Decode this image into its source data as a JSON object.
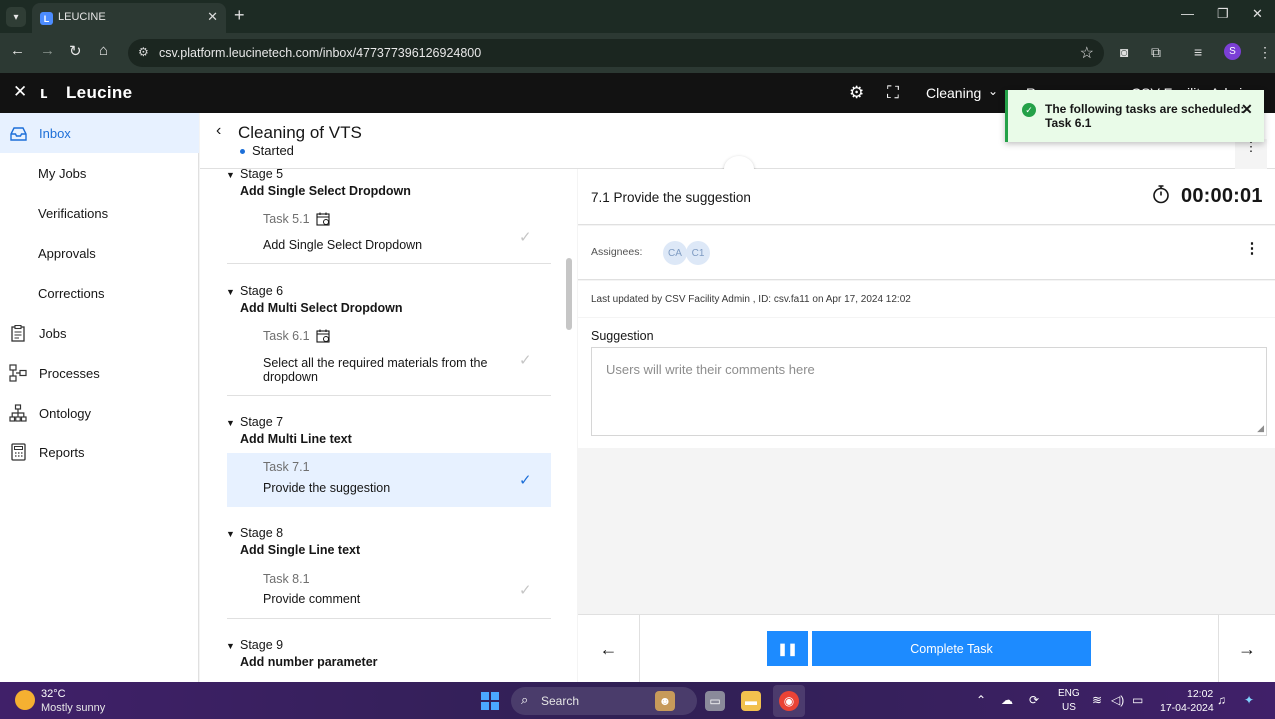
{
  "browser": {
    "tab_title": "LEUCINE",
    "url": "csv.platform.leucinetech.com/inbox/477377396126924800",
    "profile_initial": "S"
  },
  "app": {
    "brand": "Leucine",
    "facility": "Cleaning",
    "header_cut_left": "R",
    "header_cut_right": "CSV Facility Admin"
  },
  "sidebar": {
    "items": [
      {
        "label": "Inbox",
        "icon": "inbox-icon"
      },
      {
        "label": "My Jobs"
      },
      {
        "label": "Verifications"
      },
      {
        "label": "Approvals"
      },
      {
        "label": "Corrections"
      },
      {
        "label": "Jobs",
        "icon": "clipboard-icon"
      },
      {
        "label": "Processes",
        "icon": "processes-icon"
      },
      {
        "label": "Ontology",
        "icon": "ontology-icon"
      },
      {
        "label": "Reports",
        "icon": "reports-icon"
      }
    ]
  },
  "job": {
    "title": "Cleaning of VTS",
    "status": "Started"
  },
  "stages": [
    {
      "label": "Stage 5",
      "name": "Add Single Select Dropdown",
      "task": {
        "id": "Task 5.1",
        "name": "Add Single Select Dropdown",
        "scheduled": true
      }
    },
    {
      "label": "Stage 6",
      "name": "Add Multi Select Dropdown",
      "task": {
        "id": "Task 6.1",
        "name": "Select all the required materials from the dropdown",
        "scheduled": true
      }
    },
    {
      "label": "Stage 7",
      "name": "Add Multi Line text",
      "task": {
        "id": "Task 7.1",
        "name": "Provide the suggestion",
        "scheduled": false
      }
    },
    {
      "label": "Stage 8",
      "name": "Add Single Line text",
      "task": {
        "id": "Task 8.1",
        "name": "Provide comment",
        "scheduled": false
      }
    },
    {
      "label": "Stage 9",
      "name": "Add number parameter"
    }
  ],
  "task_detail": {
    "title": "7.1 Provide the suggestion",
    "timer": "00:00:01",
    "assignees_label": "Assignees:",
    "assignees": [
      "CA",
      "C1"
    ],
    "last_updated": "Last updated by CSV Facility Admin , ID: csv.fa11 on Apr 17, 2024 12:02",
    "parameter_label": "Suggestion",
    "parameter_placeholder": "Users will write their comments here"
  },
  "actions": {
    "complete_label": "Complete Task"
  },
  "toast": {
    "message": "The following tasks are scheduled: Task 6.1"
  },
  "taskbar": {
    "temp": "32°C",
    "weather": "Mostly sunny",
    "search": "Search",
    "lang1": "ENG",
    "lang2": "US",
    "time": "12:02",
    "date": "17-04-2024"
  }
}
